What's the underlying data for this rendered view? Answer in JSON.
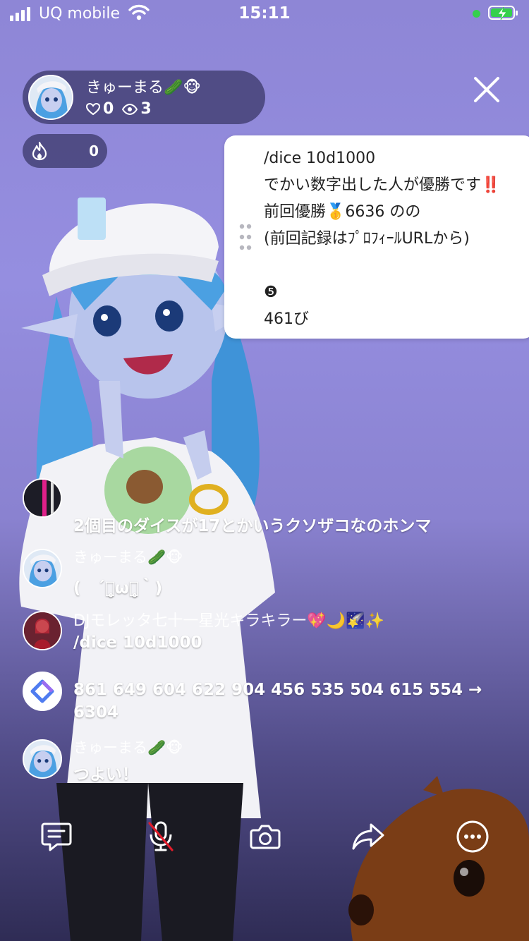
{
  "status_bar": {
    "carrier": "UQ mobile",
    "time": "15:11",
    "battery_state": "charging"
  },
  "host": {
    "name": "きゅーまる🥒🐵",
    "likes": "0",
    "viewers": "3",
    "like_icon": "heart-icon",
    "viewer_icon": "eye-icon"
  },
  "flame_badge": {
    "count": "0",
    "icon": "flame-icon"
  },
  "pinned_note": {
    "lines": [
      "/dice 10d1000",
      "でかい数字出した人が優勝です",
      "前回優勝🥇6636 のの",
      "(前回記録はﾌﾟﾛﾌｨｰﾙURLから)",
      "",
      "❺",
      "461び"
    ],
    "line2_emphasis": "‼️"
  },
  "chat": [
    {
      "name": "",
      "text": "2個目のダイスが17とかいうクソザコなのホンマ"
    },
    {
      "name": "きゅーまる🥒🐵",
      "text": "(　´･̥̥ω･̥̥｀)"
    },
    {
      "name": "DJモレッタ七十一星光キラキラー💖🌙🌠✨",
      "text": "/dice 10d1000"
    },
    {
      "name": "",
      "text": "861 649 604 622 904 456 535 504 615 554 → 6304"
    },
    {
      "name": "きゅーまる🥒🐵",
      "text": "つよい！"
    }
  ],
  "toolbar": {
    "icons": [
      "comment-icon",
      "mic-muted-icon",
      "camera-icon",
      "share-icon",
      "more-icon"
    ]
  },
  "colors": {
    "background_top": "#8e86d6",
    "background_bottom": "#2f2c55",
    "accent_green": "#35d04c",
    "emphasis_red": "#e11c2a"
  }
}
